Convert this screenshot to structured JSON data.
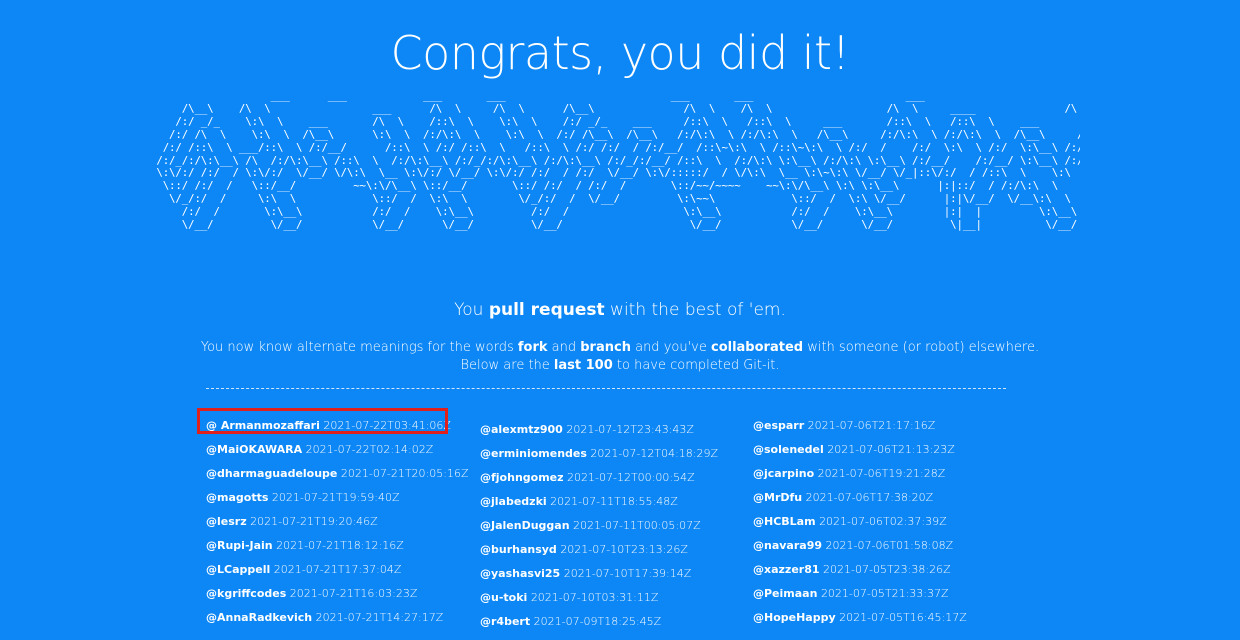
{
  "page": {
    "title": "Congrats, you did it!",
    "ascii_art_text": "                   ___      ___            ___       ___                          ___       ___                        ___                          ___\n     /\\__\\    /\\  \\                ___      /\\  \\     /\\  \\      /\\__\\              /\\  \\    /\\  \\                  /\\  \\     ____              /\\  \\\n    /:/ _/_    \\:\\  \\    ___       /\\  \\    /::\\  \\    \\:\\  \\    /:/ _/_    ___     /::\\  \\   /::\\  \\     ___       /::\\  \\   /::\\  \\    ___       /::\\  \\\n   /:/ /\\  \\    \\:\\  \\  /\\__\\      \\:\\  \\  /:/\\:\\  \\    \\:\\  \\  /:/ /\\__\\  /\\__\\   /:/\\:\\  \\ /:/\\:\\  \\   /\\__\\     /:/\\:\\  \\ /:/\\:\\  \\  /\\__\\     /:/\\:\\  \\\n  /:/ /::\\  \\ ___/::\\  \\ /:/__/      /::\\  \\ /:/ /::\\  \\   /::\\  \\ /:/ /:/  / /:/__/  /::\\~\\:\\  \\ /::\\~\\:\\  \\ /:/  /    /:/  \\:\\  \\ /:/  \\:\\__\\ /:/__/    /:/  \\:\\  \\\n /:/_/:/\\:\\__\\ /\\  /:/\\:\\__\\ /::\\  \\  /:/\\:\\__\\ /:/_/:/\\:\\__\\ /:/\\:\\__\\ /:/_/:/__/ /::\\  \\  /:/\\:\\ \\:\\__\\ /:/\\:\\ \\:\\__\\ /:/__/    /:/__/ \\:\\__\\ /:/__/ \\:|__| /::\\  \\    /:/__/ \\:\\__\\\n \\:\\/:/ /:/  / \\:\\/:/  \\/__/ \\/\\:\\  \\__ \\:\\/:/ \\/__/ \\:\\/:/ /:/  / /:/  \\/__/ \\:\\/:::::/  / \\/\\:\\  \\__ \\:\\~\\:\\ \\/__/ \\/_|::\\/:/  / /::\\  \\    \\:\\  \\ /:/  / \\:\\  \\ /:/  / \\/\\:\\  \\__ \\:\\  \\ /:/  /\n  \\::/ /:/  /   \\::/__/         ~~\\:\\/\\__\\ \\::/__/       \\::/ /:/  / /:/  /       \\::/~~/~~~~    ~~\\:\\/\\__\\ \\:\\ \\:\\__\\      |:|::/  / /:/\\:\\  \\    \\:\\  /:/  /   \\:\\  /:/  /   ~~\\:\\/\\__\\ \\:\\  /:/  /\n   \\/_/:/  /     \\:\\  \\            \\::/  /  \\:\\  \\        \\/_/:/  /  \\/__/         \\:\\~~\\            \\::/  /  \\:\\ \\/__/      |:|\\/__/  \\/__\\:\\  \\    \\:\\/:/  /     \\:\\/:/  /       \\::/  /  \\:\\/:/  /\n     /:/  /       \\:\\__\\           /:/  /    \\:\\__\\         /:/  /                  \\:\\__\\           /:/  /    \\:\\__\\        |:|  |         \\:\\__\\    \\::/  /       \\::/  /        /:/  /    \\::/  /\n     \\/__/         \\/__/           \\/__/      \\/__/         \\/__/                    \\/__/           \\/__/      \\/__/         \\|__|          \\/__/     \\/__/         \\/__/         \\/__/      \\/__/",
    "tagline": {
      "pre": "You ",
      "bold": "pull request",
      "post": " with the best of 'em."
    },
    "desc_line1": {
      "a": "You now know alternate meanings for the words ",
      "b": "fork",
      "c": " and ",
      "d": "branch",
      "e": " and you've ",
      "f": "collaborated",
      "g": " with someone (or robot) elsewhere."
    },
    "desc_line2": {
      "a": "Below are the ",
      "b": "last 100",
      "c": " to have completed Git-it."
    }
  },
  "completions": {
    "column1": [
      {
        "user": "@ Armanmozaffari",
        "time": "2021-07-22T03:41:06Z"
      },
      {
        "user": "@MaiOKAWARA",
        "time": "2021-07-22T02:14:02Z"
      },
      {
        "user": "@dharmaguadeloupe",
        "time": "2021-07-21T20:05:16Z"
      },
      {
        "user": "@magotts",
        "time": "2021-07-21T19:59:40Z"
      },
      {
        "user": "@lesrz",
        "time": "2021-07-21T19:20:46Z"
      },
      {
        "user": "@Rupi-Jain",
        "time": "2021-07-21T18:12:16Z"
      },
      {
        "user": "@LCappell",
        "time": "2021-07-21T17:37:04Z"
      },
      {
        "user": "@kgriffcodes",
        "time": "2021-07-21T16:03:23Z"
      },
      {
        "user": "@AnnaRadkevich",
        "time": "2021-07-21T14:27:17Z"
      }
    ],
    "column2": [
      {
        "user": "@alexmtz900",
        "time": "2021-07-12T23:43:43Z"
      },
      {
        "user": "@erminiomendes",
        "time": "2021-07-12T04:18:29Z"
      },
      {
        "user": "@fjohngomez",
        "time": "2021-07-12T00:00:54Z"
      },
      {
        "user": "@jlabedzki",
        "time": "2021-07-11T18:55:48Z"
      },
      {
        "user": "@JalenDuggan",
        "time": "2021-07-11T00:05:07Z"
      },
      {
        "user": "@burhansyd",
        "time": "2021-07-10T23:13:26Z"
      },
      {
        "user": "@yashasvi25",
        "time": "2021-07-10T17:39:14Z"
      },
      {
        "user": "@u-toki",
        "time": "2021-07-10T03:31:11Z"
      },
      {
        "user": "@r4bert",
        "time": "2021-07-09T18:25:45Z"
      }
    ],
    "column3": [
      {
        "user": "@esparr",
        "time": "2021-07-06T21:17:16Z"
      },
      {
        "user": "@solenedel",
        "time": "2021-07-06T21:13:23Z"
      },
      {
        "user": "@jcarpino",
        "time": "2021-07-06T19:21:28Z"
      },
      {
        "user": "@MrDfu",
        "time": "2021-07-06T17:38:20Z"
      },
      {
        "user": "@HCBLam",
        "time": "2021-07-06T02:37:39Z"
      },
      {
        "user": "@navara99",
        "time": "2021-07-06T01:58:08Z"
      },
      {
        "user": "@xazzer81",
        "time": "2021-07-05T23:38:26Z"
      },
      {
        "user": "@Peimaan",
        "time": "2021-07-05T21:33:37Z"
      },
      {
        "user": "@HopeHappy",
        "time": "2021-07-05T16:45:17Z"
      }
    ]
  },
  "highlight_color": "#e0201c",
  "background_color": "#0d87f5"
}
